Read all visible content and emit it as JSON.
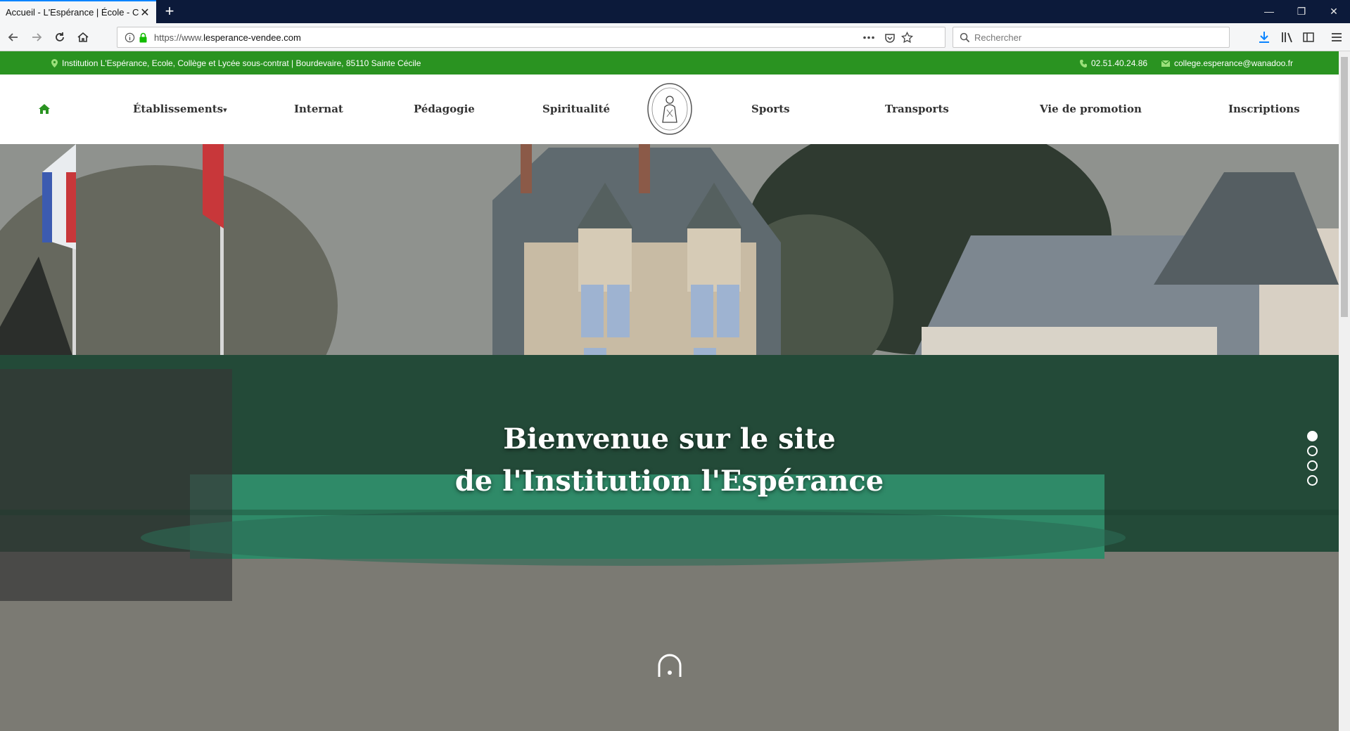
{
  "browser": {
    "tab_title": "Accueil - L'Espérance | École - Collè",
    "tab_close": "✕",
    "new_tab": "+",
    "url_prefix": "https://www.",
    "url_domain": "lesperance-vendee.com",
    "search_placeholder": "Rechercher",
    "win_minimize": "—",
    "win_restore": "❐",
    "win_close": "✕",
    "colors": {
      "tabbar": "#0c1a3a",
      "active_tab_accent": "#0a84ff",
      "download_icon": "#0a84ff"
    }
  },
  "topbar": {
    "address": "Institution L'Espérance, Ecole, Collège et Lycée sous-contrat | Bourdevaire, 85110 Sainte Cécile",
    "phone": "02.51.40.24.86",
    "email": "college.esperance@wanadoo.fr",
    "color": "#2a9321"
  },
  "menu": {
    "home_icon": "home-icon",
    "items_left": [
      "Établissements",
      "Internat",
      "Pédagogie",
      "Spiritualité"
    ],
    "items_right": [
      "Sports",
      "Transports",
      "Vie de promotion",
      "Inscriptions"
    ],
    "dropdown_marker": "▾"
  },
  "hero": {
    "title_line1": "Bienvenue sur le site",
    "title_line2": "de l'Institution l'Espérance",
    "slides": 4,
    "active_slide": 1
  }
}
